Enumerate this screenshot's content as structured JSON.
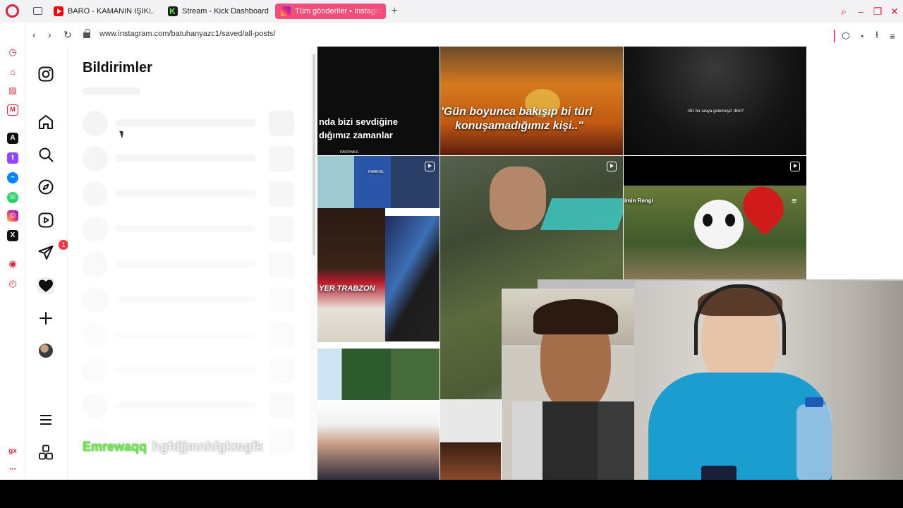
{
  "browser": {
    "tabs": [
      {
        "label": "BARO - KAMANIN IŞIKLAR",
        "favicon": "youtube-icon"
      },
      {
        "label": "Stream - Kick Dashboard",
        "favicon": "kick-icon"
      },
      {
        "label": "Tüm gönderiler • Instagra",
        "favicon": "instagram-icon",
        "active": true
      }
    ],
    "url": "www.instagram.com/batuhanyazc1/saved/all-posts/",
    "accent": "#f34e7a"
  },
  "instagram": {
    "nav": {
      "messages_badge": "1"
    },
    "notifications": {
      "title": "Bildirimler"
    },
    "grid": {
      "captions": {
        "post1_line1": "nda bizi sevdiğine",
        "post1_line2": "dığımız zamanlar",
        "post2_line1": "'Gün boyunca bakışıp bi türl",
        "post2_line2": "konuşamadığımız kişi..\"",
        "post3": "-Biz bir araya gelemeyiz dimi?",
        "post6_label": "imin Rengi",
        "post4_banner": "YER TRABZON",
        "post1_small": "PAOFHALIL",
        "post4_jersey": "RAMERIL"
      }
    }
  },
  "stream_overlay": {
    "chat_user": "Emrewaqq",
    "chat_message": "hgfdjjmnhfgkmgfk"
  }
}
